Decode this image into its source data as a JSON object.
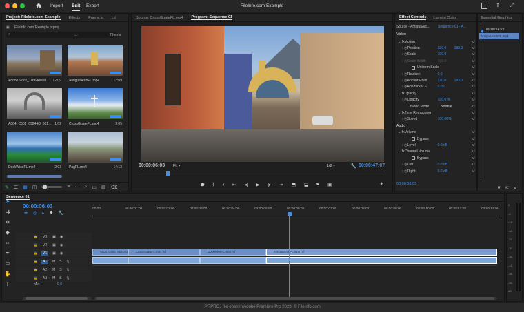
{
  "app": {
    "window_title": "FileInfo.com Example",
    "menu": [
      "Import",
      "Edit",
      "Export"
    ],
    "footer": ".PRPROJ file open in Adobe Premiere Pro 2023. © FileInfo.com"
  },
  "project": {
    "tabs": [
      "Project: FileInfo.com Example",
      "Effects",
      "Frame.io",
      "Lit"
    ],
    "file": "FileInfo.com Example.prproj",
    "count": "7 Items",
    "items": [
      {
        "name": "AdobeStock_116640099...",
        "dur": "12:09"
      },
      {
        "name": "AntiguaArchFL.mp4",
        "dur": "13:09"
      },
      {
        "name": "A004_C002_09244Q_001...",
        "dur": "1:02"
      },
      {
        "name": "CrossGuateFL.mp4",
        "dur": "2:05"
      },
      {
        "name": "DockWiseFL.mp4",
        "dur": "2:03"
      },
      {
        "name": "PagFL.mp4",
        "dur": "14:13"
      }
    ]
  },
  "source_tab": "Source: CrossGuateFL.mp4",
  "program": {
    "tab": "Program: Sequence 01",
    "timecode": "00:00:06:03",
    "fit": "Fit",
    "resolution": "1/2",
    "duration": "00:00:47:07"
  },
  "effects": {
    "tabs": [
      "Effect Controls",
      "Lumetri Color",
      "Essential Graphics"
    ],
    "source": "Source - AntiguaArc...",
    "sequence": "Sequence 01 - A...",
    "clip_chip": "AntiguaArchFL.mp4",
    "chip_time": "00:00:14:23",
    "footer_time": "00:00:06:03",
    "video_label": "Video",
    "rows": [
      {
        "label": "Motion",
        "value": "",
        "kind": "fx"
      },
      {
        "label": "Position",
        "value": "320.0",
        "value2": "180.0",
        "kind": "prop"
      },
      {
        "label": "Scale",
        "value": "100.0",
        "kind": "prop"
      },
      {
        "label": "Scale Width",
        "value": "100.0",
        "kind": "dim"
      },
      {
        "label": "Uniform Scale",
        "value": "",
        "kind": "check"
      },
      {
        "label": "Rotation",
        "value": "0.0",
        "kind": "prop"
      },
      {
        "label": "Anchor Point",
        "value": "320.0",
        "value2": "180.0",
        "kind": "prop"
      },
      {
        "label": "Anti-flicker F...",
        "value": "0.00",
        "kind": "prop"
      },
      {
        "label": "Opacity",
        "value": "",
        "kind": "fx"
      },
      {
        "label": "Opacity",
        "value": "100.0 %",
        "kind": "prop"
      },
      {
        "label": "Blend Mode",
        "value": "Normal",
        "kind": "select"
      },
      {
        "label": "Time Remapping",
        "value": "",
        "kind": "fx"
      },
      {
        "label": "Speed",
        "value": "100.00%",
        "kind": "prop"
      },
      {
        "label": "Audio",
        "value": "",
        "kind": "section"
      },
      {
        "label": "Volume",
        "value": "",
        "kind": "fx"
      },
      {
        "label": "Bypass",
        "value": "",
        "kind": "check"
      },
      {
        "label": "Level",
        "value": "0.0 dB",
        "kind": "prop"
      },
      {
        "label": "Channel Volume",
        "value": "",
        "kind": "fx"
      },
      {
        "label": "Bypass",
        "value": "",
        "kind": "check"
      },
      {
        "label": "Left",
        "value": "0.0 dB",
        "kind": "prop"
      },
      {
        "label": "Right",
        "value": "0.0 dB",
        "kind": "prop"
      }
    ]
  },
  "timeline": {
    "tab": "Sequence 01",
    "timecode": "00:00:06:03",
    "ruler": [
      "00:00",
      "00:00:01:00",
      "00:00:02:00",
      "00:00:03:00",
      "00:00:04:00",
      "00:00:05:00",
      "00:00:06:00",
      "00:00:07:00",
      "00:00:08:00",
      "00:00:09:00",
      "00:00:10:00",
      "00:00:11:00",
      "00:00:12:00"
    ],
    "video_tracks": [
      "V3",
      "V2",
      "V1"
    ],
    "audio_tracks": [
      "A1",
      "A2",
      "A3"
    ],
    "mix": "Mix",
    "mix_value": "0.0",
    "clips": [
      "A004_C002_09244Q...",
      "CrossGuateFL.mp4 [V]",
      "DockWiseFL.mp4 [V]",
      "AntiguaArchFL.mp4 [V]"
    ],
    "meter_ticks": [
      "0",
      "-6",
      "-12",
      "-18",
      "-24",
      "-30",
      "-36",
      "-42",
      "-48",
      "-54",
      "dB"
    ]
  },
  "colors": {
    "accent": "#3a8ef0",
    "clip_video": "#6a8fc7",
    "playhead": "#4a90e2"
  }
}
